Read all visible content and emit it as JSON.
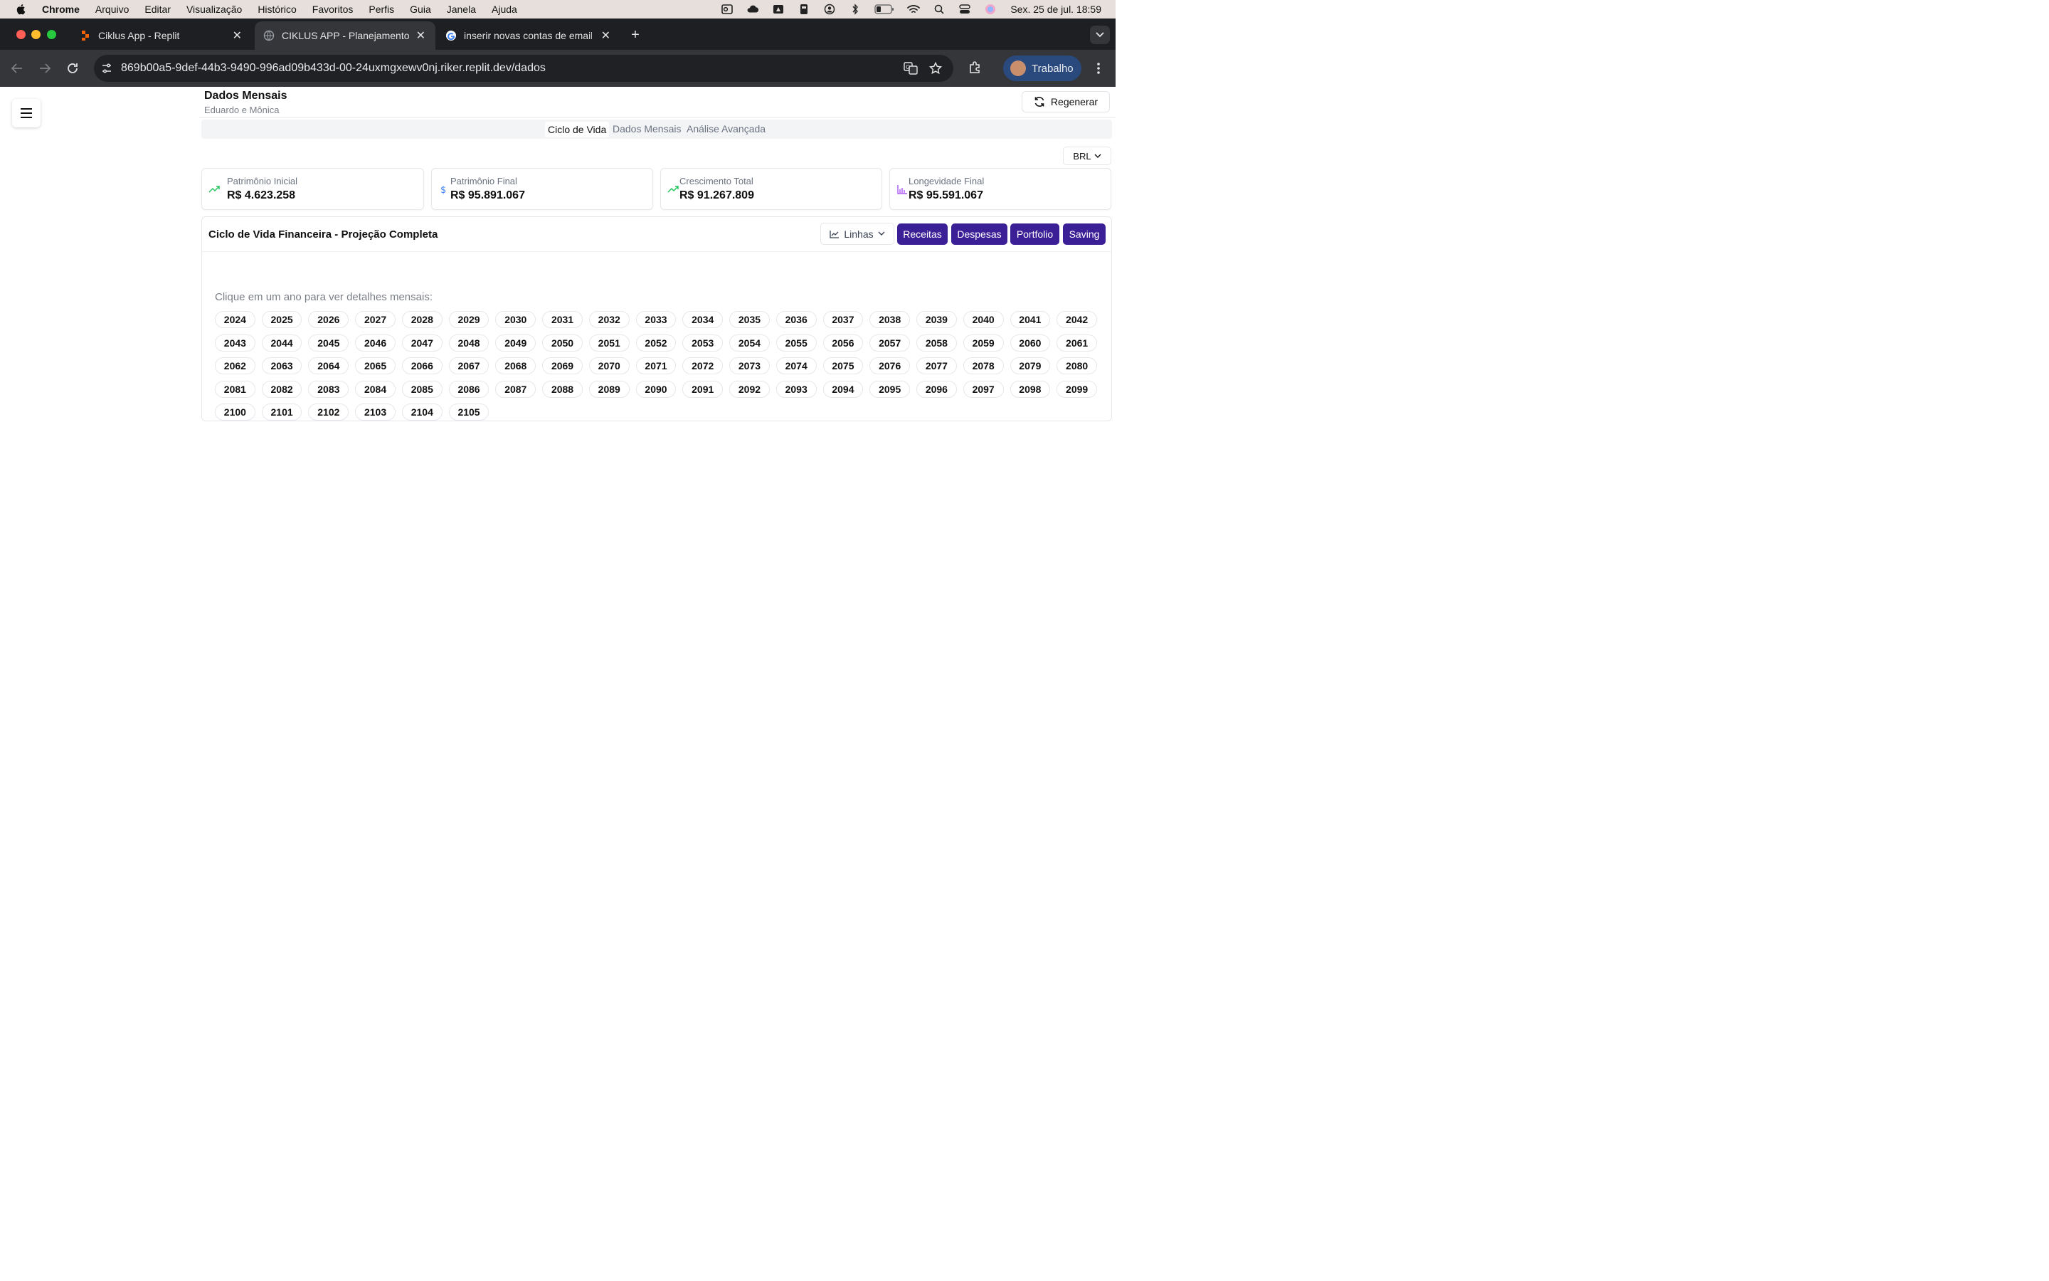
{
  "menubar": {
    "app": "Chrome",
    "items": [
      "Arquivo",
      "Editar",
      "Visualização",
      "Histórico",
      "Favoritos",
      "Perfis",
      "Guia",
      "Janela",
      "Ajuda"
    ],
    "clock": "Sex. 25 de jul.  18:59"
  },
  "browser": {
    "tabs": [
      {
        "title": "Ciklus App - Replit"
      },
      {
        "title": "CIKLUS APP - Planejamento F"
      },
      {
        "title": "inserir novas contas de email"
      }
    ],
    "url": "869b00a5-9def-44b3-9490-996ad09b433d-00-24uxmgxewv0nj.riker.replit.dev/dados",
    "profile": "Trabalho"
  },
  "header": {
    "title": "Dados Mensais",
    "subtitle": "Eduardo e Mônica",
    "regenerate": "Regenerar"
  },
  "nav_tabs": [
    "Ciclo de Vida",
    "Dados Mensais",
    "Análise Avançada"
  ],
  "currency": "BRL",
  "stats": [
    {
      "label": "Patrimônio Inicial",
      "value": "R$ 4.623.258",
      "icon": "trending-up-icon",
      "color": "#22c55e"
    },
    {
      "label": "Patrimônio Final",
      "value": "R$ 95.891.067",
      "icon": "dollar-icon",
      "color": "#3b82f6"
    },
    {
      "label": "Crescimento Total",
      "value": "R$ 91.267.809",
      "icon": "trending-up-icon",
      "color": "#22c55e"
    },
    {
      "label": "Longevidade Final",
      "value": "R$ 95.591.067",
      "icon": "bar-chart-icon",
      "color": "#a855f7"
    }
  ],
  "chart": {
    "title": "Ciclo de Vida Financeira - Projeção Completa",
    "view": "Linhas",
    "series_buttons": [
      "Receitas",
      "Despesas",
      "Portfolio",
      "Saving"
    ],
    "accent": "#3b1f96",
    "hint": "Clique em um ano para ver detalhes mensais:",
    "year_rows": [
      [
        "2024",
        "2025",
        "2026",
        "2027",
        "2028",
        "2029",
        "2030",
        "2031",
        "2032",
        "2033",
        "2034",
        "2035",
        "2036",
        "2037",
        "2038",
        "2039",
        "2040",
        "2041",
        "2042"
      ],
      [
        "2043",
        "2044",
        "2045",
        "2046",
        "2047",
        "2048",
        "2049",
        "2050",
        "2051",
        "2052",
        "2053",
        "2054",
        "2055",
        "2056",
        "2057",
        "2058",
        "2059",
        "2060",
        "2061"
      ],
      [
        "2062",
        "2063",
        "2064",
        "2065",
        "2066",
        "2067",
        "2068",
        "2069",
        "2070",
        "2071",
        "2072",
        "2073",
        "2074",
        "2075",
        "2076",
        "2077",
        "2078",
        "2079",
        "2080"
      ],
      [
        "2081",
        "2082",
        "2083",
        "2084",
        "2085",
        "2086",
        "2087",
        "2088",
        "2089",
        "2090",
        "2091",
        "2092",
        "2093",
        "2094",
        "2095",
        "2096",
        "2097",
        "2098",
        "2099"
      ],
      [
        "2100",
        "2101",
        "2102",
        "2103",
        "2104",
        "2105"
      ]
    ]
  }
}
